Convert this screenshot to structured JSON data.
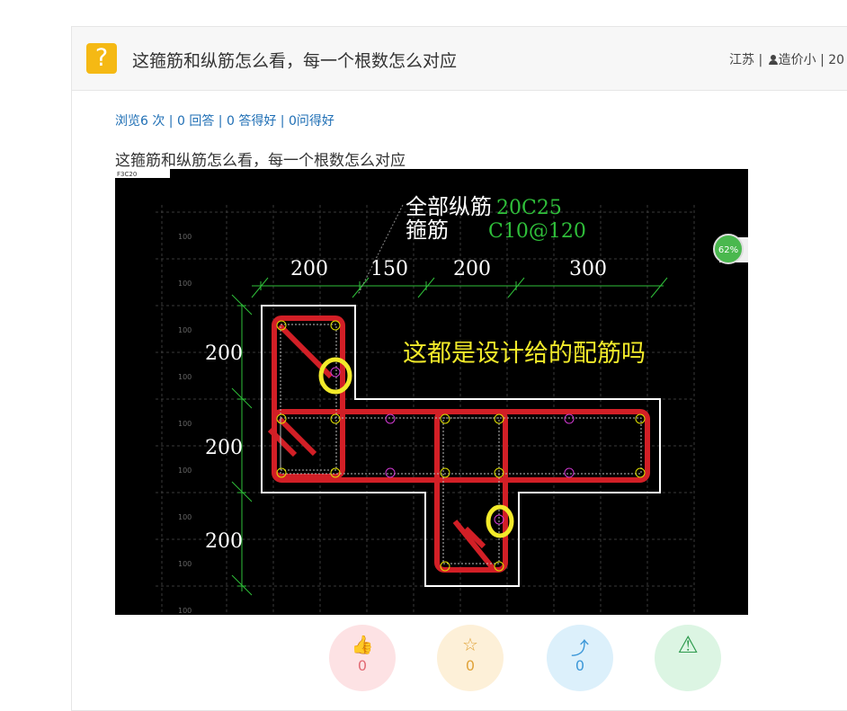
{
  "question": {
    "icon": "question-mark-icon",
    "icon_glyph": "?",
    "title": "这箍筋和纵筋怎么看，每一个根数怎么对应",
    "region": "江苏",
    "separator1": " | ",
    "user_icon": "user-icon",
    "author": "造价小",
    "separator2": " | ",
    "date_partial": "20"
  },
  "stats": {
    "views": "浏览6 次",
    "answers": "0 回答",
    "good_answers": "0 答得好",
    "good_questions": "0问得好",
    "sep": " | "
  },
  "body": {
    "text": "这箍筋和纵筋怎么看，每一个根数怎么对应"
  },
  "drawing": {
    "tag": "F3C20",
    "note_all_longitudinal_label": "全部纵筋",
    "note_all_longitudinal_value": "20C25",
    "note_stirrup_label": "箍筋",
    "note_stirrup_value": "C10@120",
    "question_text": "这都是设计给的配筋吗",
    "dims_top": [
      "200",
      "150",
      "200",
      "300"
    ],
    "dims_left": [
      "200",
      "200",
      "200"
    ],
    "grid_labels": [
      "100",
      "100",
      "100",
      "100",
      "100",
      "100",
      "100",
      "100",
      "100",
      "100"
    ],
    "progress_badge": "62%",
    "colors": {
      "background": "#000000",
      "outline": "#ffffff",
      "rebar": "#d21f26",
      "dimension": "#2fbf3a",
      "annotation": "#f2ea2a",
      "bar_marker": "#e0e000",
      "extra_bar": "#d23ad2"
    }
  },
  "actions": [
    {
      "name": "like",
      "icon": "thumbs-up-icon",
      "glyph": "👍",
      "count": "0",
      "bg": "#fde2e4",
      "fg": "#e26b75"
    },
    {
      "name": "favorite",
      "icon": "star-icon",
      "glyph": "☆",
      "count": "0",
      "bg": "#fdf0d8",
      "fg": "#e0a33a"
    },
    {
      "name": "share",
      "icon": "share-icon",
      "glyph": "⤴",
      "count": "0",
      "bg": "#dcf0fb",
      "fg": "#3d98d8"
    },
    {
      "name": "report",
      "icon": "warning-icon",
      "glyph": "⚠",
      "count": "",
      "bg": "#dcf5e3",
      "fg": "#2d9a4d"
    }
  ]
}
